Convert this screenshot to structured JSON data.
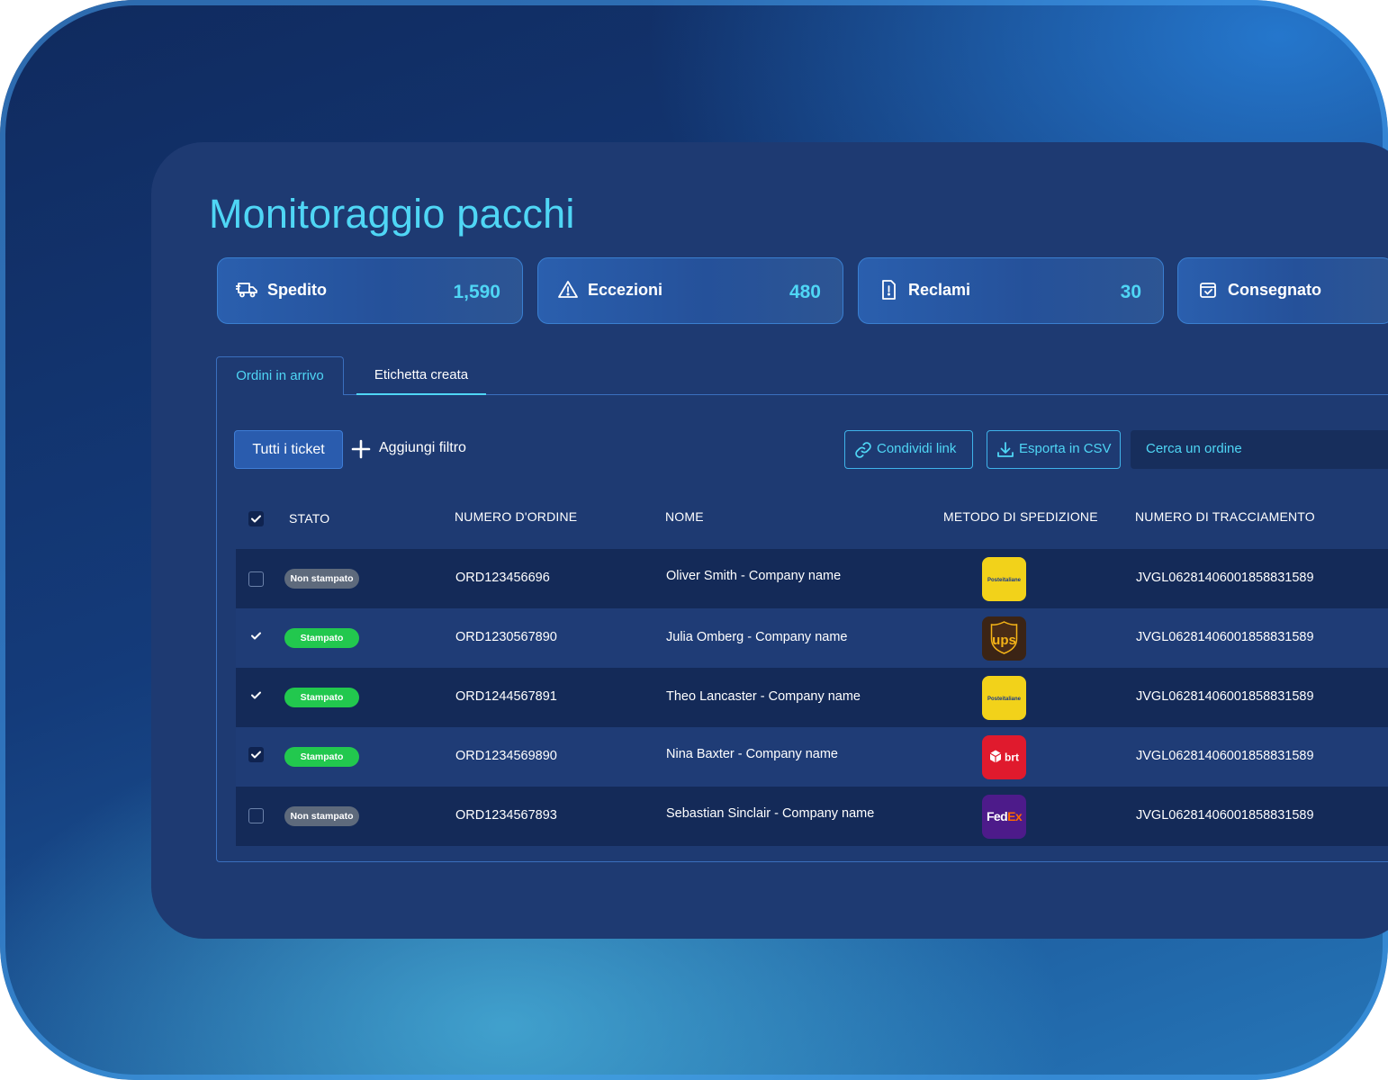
{
  "page": {
    "title": "Monitoraggio pacchi"
  },
  "stats": [
    {
      "label": "Spedito",
      "value": "1,590",
      "icon": "truck-icon"
    },
    {
      "label": "Eccezioni",
      "value": "480",
      "icon": "warning-icon"
    },
    {
      "label": "Reclami",
      "value": "30",
      "icon": "document-alert-icon"
    },
    {
      "label": "Consegnato",
      "value": "",
      "icon": "box-check-icon"
    }
  ],
  "tabs": [
    {
      "label": "Ordini in arrivo",
      "active": false
    },
    {
      "label": "Etichetta creata",
      "active": true
    }
  ],
  "toolbar": {
    "filter_label": "Tutti i ticket",
    "add_filter_label": "Aggiungi filtro",
    "share_label": "Condividi link",
    "export_label": "Esporta in CSV",
    "search_placeholder": "Cerca un ordine"
  },
  "table": {
    "header_checked": true,
    "columns": [
      "STATO",
      "NUMERO D'ORDINE",
      "NOME",
      "METODO DI SPEDIZIONE",
      "NUMERO DI TRACCIAMENTO"
    ],
    "rows": [
      {
        "checked": false,
        "status": "Non stampato",
        "order": "ORD123456696",
        "name": "Oliver Smith - Company name",
        "carrier": "Posteitaliane",
        "tracking": "JVGL06281406001858831589"
      },
      {
        "checked": true,
        "status": "Stampato",
        "order": "ORD1230567890",
        "name": "Julia Omberg - Company name",
        "carrier": "ups",
        "tracking": "JVGL06281406001858831589"
      },
      {
        "checked": true,
        "status": "Stampato",
        "order": "ORD1244567891",
        "name": "Theo Lancaster - Company name",
        "carrier": "Posteitaliane",
        "tracking": "JVGL06281406001858831589"
      },
      {
        "checked": true,
        "status": "Stampato",
        "order": "ORD1234569890",
        "name": "Nina Baxter - Company name",
        "carrier": "brt",
        "tracking": "JVGL06281406001858831589"
      },
      {
        "checked": false,
        "status": "Non stampato",
        "order": "ORD1234567893",
        "name": "Sebastian Sinclair - Company name",
        "carrier": "FedEx",
        "tracking": "JVGL06281406001858831589"
      }
    ]
  },
  "colors": {
    "accent": "#4fd6f5",
    "printed": "#22c84e",
    "not_printed": "#5e6a7c",
    "panel": "#1e3a72"
  }
}
